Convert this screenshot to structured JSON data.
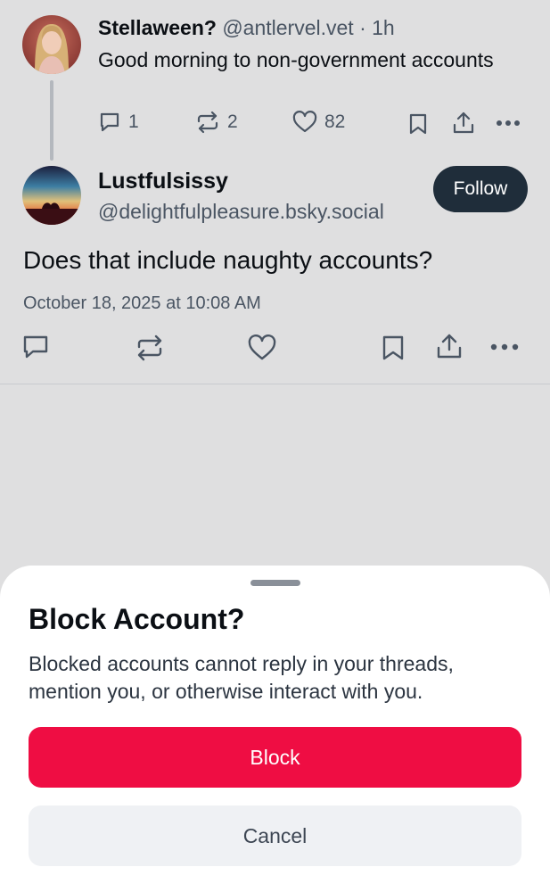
{
  "parent_post": {
    "display_name": "Stellaween?",
    "handle": "@antlervel.vet",
    "separator": "·",
    "time_ago": "1h",
    "text": "Good morning to non-government accounts",
    "reply_count": "1",
    "repost_count": "2",
    "like_count": "82",
    "icons": [
      "reply-icon",
      "repost-icon",
      "like-icon",
      "bookmark-icon",
      "share-icon",
      "more-icon"
    ]
  },
  "main_post": {
    "display_name": "Lustfulsissy",
    "handle": "@delightfulpleasure.bsky.social",
    "follow_label": "Follow",
    "text": "Does that include naughty accounts?",
    "timestamp": "October 18, 2025 at 10:08 AM",
    "icons": [
      "reply-icon",
      "repost-icon",
      "like-icon",
      "bookmark-icon",
      "share-icon",
      "more-icon"
    ]
  },
  "block_sheet": {
    "title": "Block Account?",
    "description": "Blocked accounts cannot reply in your threads, mention you, or otherwise interact with you.",
    "block_label": "Block",
    "cancel_label": "Cancel"
  },
  "colors": {
    "backdrop": "#dfdfe0",
    "follow_button": "#1f2d3a",
    "block_button": "#ef0d43",
    "cancel_button": "#eff1f4",
    "secondary_text": "#4a5563"
  }
}
